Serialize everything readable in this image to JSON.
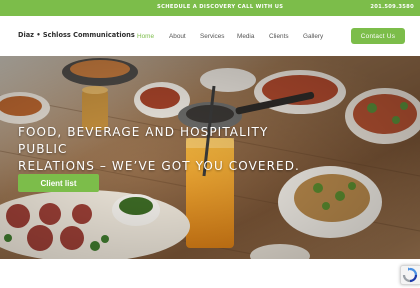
{
  "topbar": {
    "cta_label": "Schedule a discovery call with us",
    "phone": "201.509.3580"
  },
  "header": {
    "logo_text": "Diaz • Schloss Communications",
    "nav": [
      {
        "label": "Home",
        "active": true
      },
      {
        "label": "About",
        "active": false
      },
      {
        "label": "Services",
        "active": false
      },
      {
        "label": "Media",
        "active": false
      },
      {
        "label": "Clients",
        "active": false
      },
      {
        "label": "Gallery",
        "active": false
      }
    ],
    "contact_label": "Contact Us"
  },
  "hero": {
    "headline_line1": "Food, beverage and hospitality public",
    "headline_line2": "relations – we’ve got you covered.",
    "button_label": "Client list"
  },
  "colors": {
    "accent": "#7cbd4a",
    "nav_text": "#555555",
    "logo_text": "#2f2f2f"
  },
  "icons": [
    "recaptcha-icon"
  ]
}
